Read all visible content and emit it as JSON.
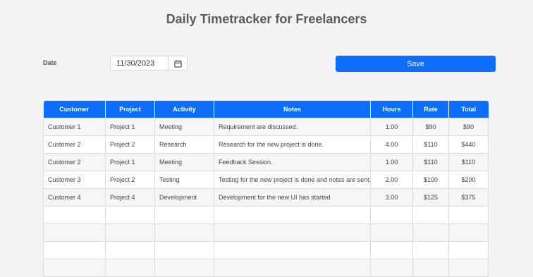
{
  "page": {
    "title": "Daily Timetracker for Freelancers"
  },
  "form": {
    "date_label": "Date",
    "date_value": "11/30/2023",
    "save_label": "Save",
    "calendar_icon": "calendar-icon"
  },
  "table": {
    "headers": [
      "Customer",
      "Project",
      "Activity",
      "Notes",
      "Hours",
      "Rate",
      "Total"
    ],
    "rows": [
      [
        "Customer 1",
        "Project 1",
        "Meeting",
        "Requirement are discussed.",
        "1.00",
        "$90",
        "$90"
      ],
      [
        "Customer 2",
        "Project 2",
        "Research",
        "Research for the new project is done.",
        "4.00",
        "$110",
        "$440"
      ],
      [
        "Customer 2",
        "Project 1",
        "Meeting",
        "Feedback Session.",
        "1.00",
        "$110",
        "$110"
      ],
      [
        "Customer 3",
        "Project 2",
        "Testing",
        "Testing for the new project is done and notes are sent.",
        "2.00",
        "$100",
        "$200"
      ],
      [
        "Customer 4",
        "Project 4",
        "Development",
        "Development for the new UI has started",
        "3.00",
        "$125",
        "$375"
      ],
      [
        "",
        "",
        "",
        "",
        "",
        "",
        ""
      ],
      [
        "",
        "",
        "",
        "",
        "",
        "",
        ""
      ],
      [
        "",
        "",
        "",
        "",
        "",
        "",
        ""
      ],
      [
        "",
        "",
        "",
        "",
        "",
        "",
        ""
      ]
    ]
  },
  "colors": {
    "accent": "#0d6efd",
    "background": "#f3f3f5"
  }
}
